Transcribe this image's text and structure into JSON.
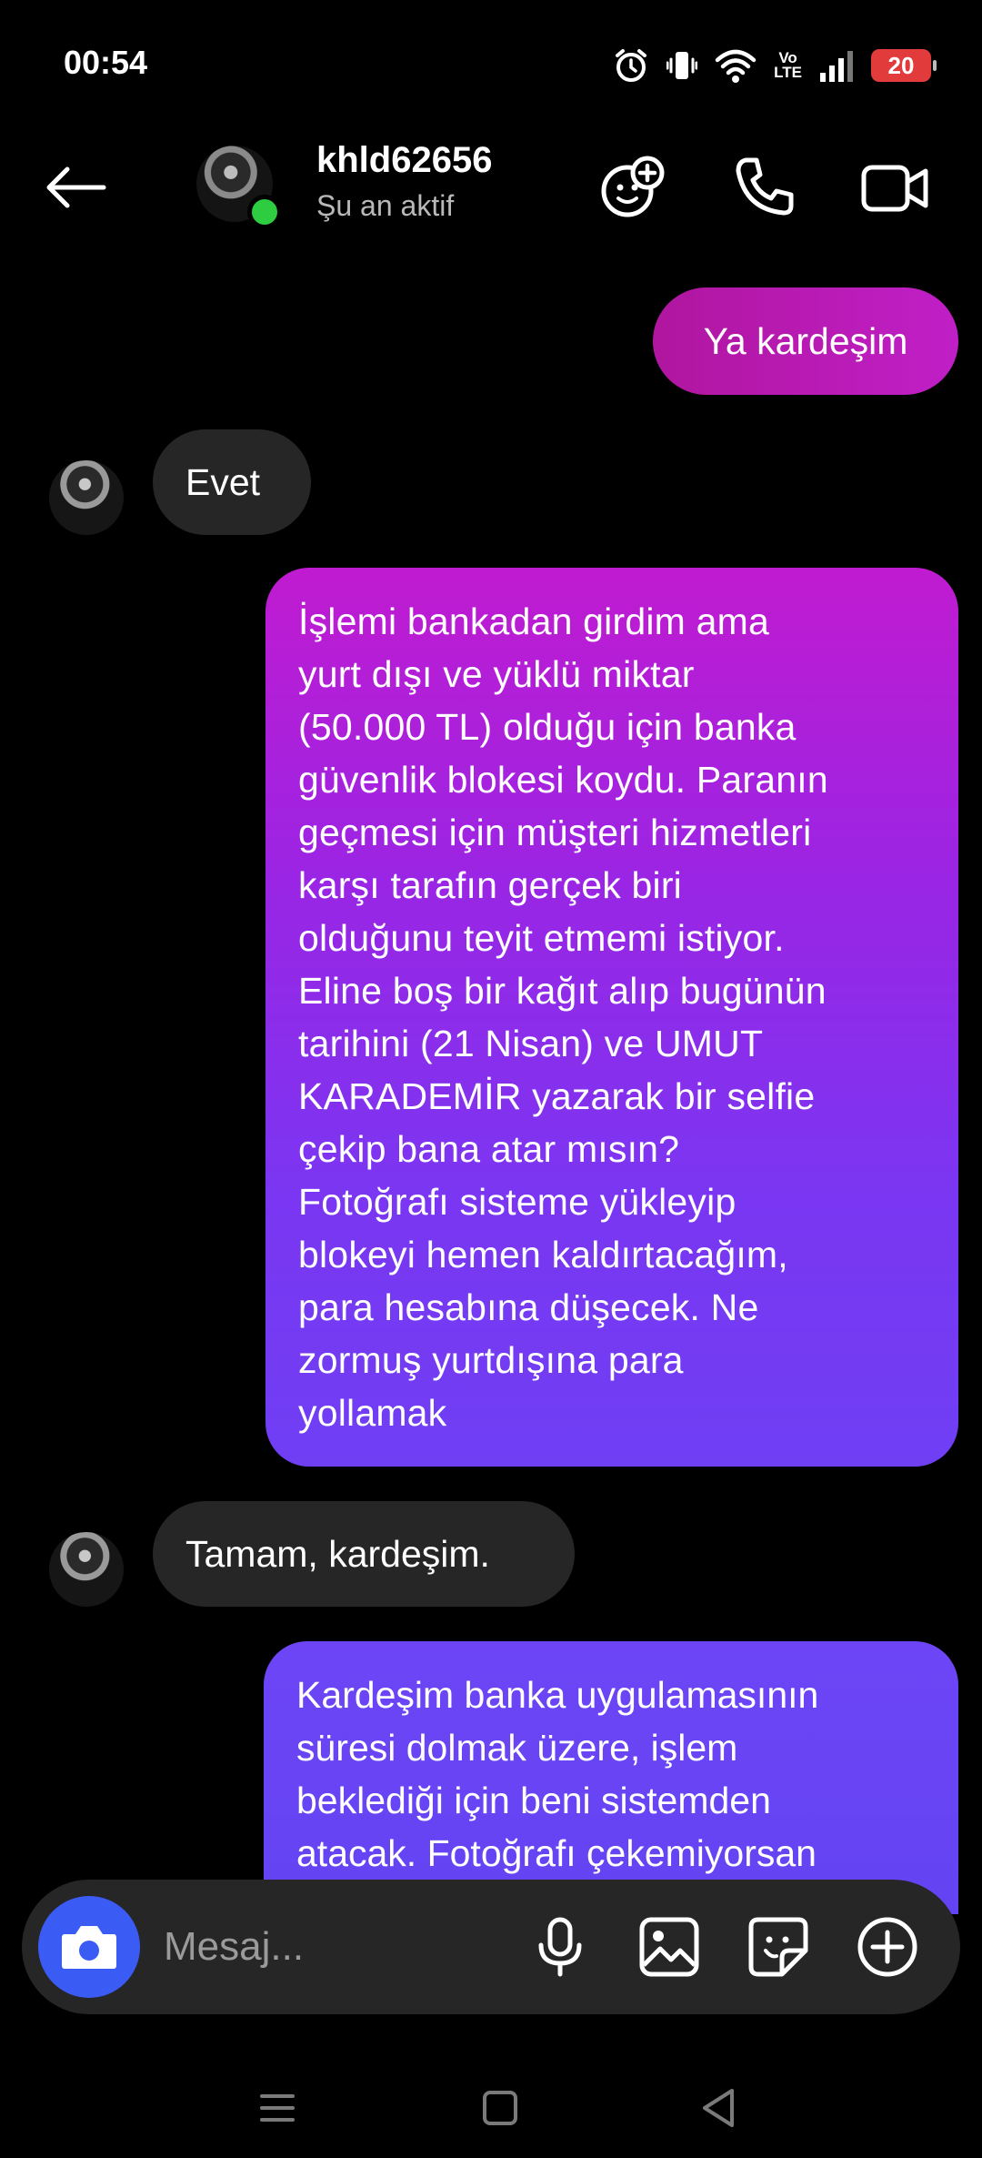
{
  "status_bar": {
    "time": "00:54",
    "volte_top": "Vo",
    "volte_bottom": "LTE",
    "battery": "20",
    "icons": [
      "alarm-icon",
      "vibrate-icon",
      "wifi-icon",
      "volte-icon",
      "signal-icon",
      "battery-icon"
    ]
  },
  "header": {
    "contact_name": "khld62656",
    "contact_status": "Şu an aktif",
    "icons": [
      "back-arrow-icon",
      "sticker-call-icon",
      "phone-icon",
      "video-icon"
    ]
  },
  "messages": [
    {
      "direction": "out",
      "lines": [
        "Ya kardeşim"
      ]
    },
    {
      "direction": "in",
      "lines": [
        "Evet"
      ]
    },
    {
      "direction": "out",
      "lines": [
        "İşlemi bankadan girdim ama",
        "yurt dışı ve yüklü miktar",
        "(50.000 TL) olduğu için banka",
        "güvenlik blokesi koydu. Paranın",
        "geçmesi için müşteri hizmetleri",
        "karşı tarafın gerçek biri",
        "olduğunu teyit etmemi istiyor.",
        "Eline boş bir kağıt alıp bugünün",
        "tarihini (21 Nisan) ve UMUT",
        "KARADEMİR yazarak bir selfie",
        "çekip bana atar mısın?",
        "Fotoğrafı sisteme yükleyip",
        "blokeyi hemen kaldırtacağım,",
        "para hesabına düşecek. Ne",
        "zormuş yurtdışına para",
        "yollamak"
      ]
    },
    {
      "direction": "in",
      "lines": [
        "Tamam, kardeşim."
      ]
    },
    {
      "direction": "out",
      "lines": [
        "Kardeşim banka uygulamasının",
        "süresi dolmak üzere, işlem",
        "beklediği için beni sistemden",
        "atacak. Fotoğrafı çekemiyorsan"
      ]
    }
  ],
  "composer": {
    "placeholder": "Mesaj...",
    "icons": [
      "camera-icon",
      "microphone-icon",
      "gallery-icon",
      "sticker-icon",
      "plus-icon"
    ]
  },
  "colors": {
    "background": "#000000",
    "incoming_bubble": "#262626",
    "outgoing_top": "#c01bd0",
    "outgoing_bottom": "#6344f2",
    "camera_button": "#3a5cf5",
    "online": "#2ecc40",
    "battery_low": "#e23b3b"
  }
}
